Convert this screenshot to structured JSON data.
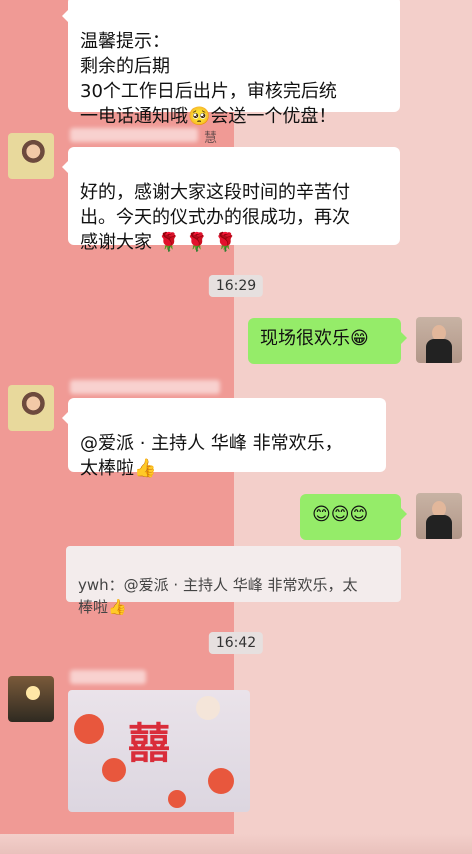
{
  "messages": {
    "m1": "温馨提示：\n剩余的后期\n30个工作日后出片，审核完后统\n一电话通知哦🥺会送一个优盘！",
    "sender2_visible": "慧",
    "m2": "好的，感谢大家这段时间的辛苦付\n出。今天的仪式办的很成功，再次\n感谢大家 🌹 🌹 🌹",
    "time1": "16:29",
    "m3": "现场很欢乐😁",
    "m4": "@爱派 · 主持人  华峰 非常欢乐，\n太棒啦👍",
    "m5": "😊😊😊",
    "quote": "ywh：@爱派 · 主持人  华峰 非常欢乐，太\n棒啦👍",
    "time2": "16:42"
  },
  "image_message": {
    "text": "囍"
  },
  "colors": {
    "left_bg": "#f09a95",
    "right_bg": "#f3cfca",
    "my_bubble": "#95ec69",
    "other_bubble": "#ffffff"
  }
}
